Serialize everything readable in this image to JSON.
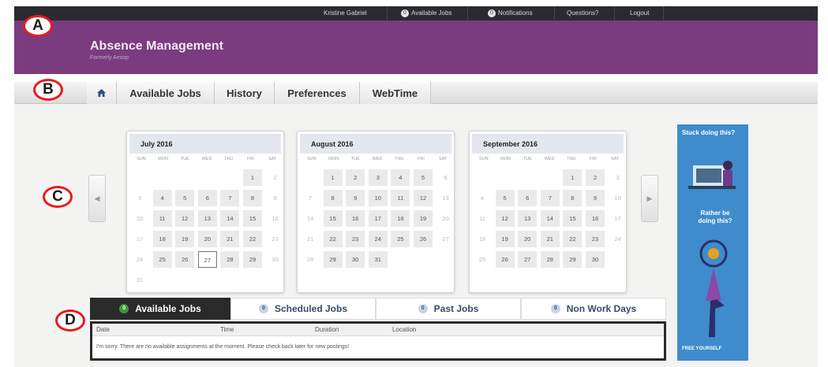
{
  "header": {
    "user_name": "Kristine Gabriel",
    "available_jobs": {
      "count": "0",
      "label": "Available Jobs"
    },
    "notifications": {
      "count": "0",
      "label": "Notifications"
    },
    "questions": "Questions?",
    "logout": "Logout",
    "app_title": "Absence Management",
    "app_subtitle": "Formerly Aesop",
    "color": "#7a3b7f"
  },
  "tabs": {
    "home_icon": "home-icon",
    "items": [
      "Available Jobs",
      "History",
      "Preferences",
      "WebTime"
    ]
  },
  "markers": [
    "A",
    "B",
    "C",
    "D"
  ],
  "calendars": [
    {
      "title": "July 2016",
      "dow": [
        "SUN",
        "MON",
        "TUE",
        "WED",
        "THU",
        "FRI",
        "SAT"
      ],
      "first_weekday": 5,
      "days": 31,
      "today": 27
    },
    {
      "title": "August 2016",
      "dow": [
        "SUN",
        "MON",
        "TUE",
        "WED",
        "THU",
        "FRI",
        "SAT"
      ],
      "first_weekday": 1,
      "days": 31
    },
    {
      "title": "September 2016",
      "dow": [
        "SUN",
        "MON",
        "TUE",
        "WED",
        "THU",
        "FRI",
        "SAT"
      ],
      "first_weekday": 4,
      "days": 30
    }
  ],
  "ad": {
    "line1": "Stuck doing this?",
    "line2": "Rather be doing this?",
    "line3": "FREE YOURSELF"
  },
  "job_tabs": [
    {
      "count": "0",
      "label": "Available Jobs"
    },
    {
      "count": "0",
      "label": "Scheduled Jobs"
    },
    {
      "count": "0",
      "label": "Past Jobs"
    },
    {
      "count": "0",
      "label": "Non Work Days"
    }
  ],
  "table": {
    "columns": [
      "Date",
      "Time",
      "Duration",
      "Location"
    ],
    "empty_message": "I'm sorry. There are no available assignments at the moment. Please check back later for new postings!"
  }
}
